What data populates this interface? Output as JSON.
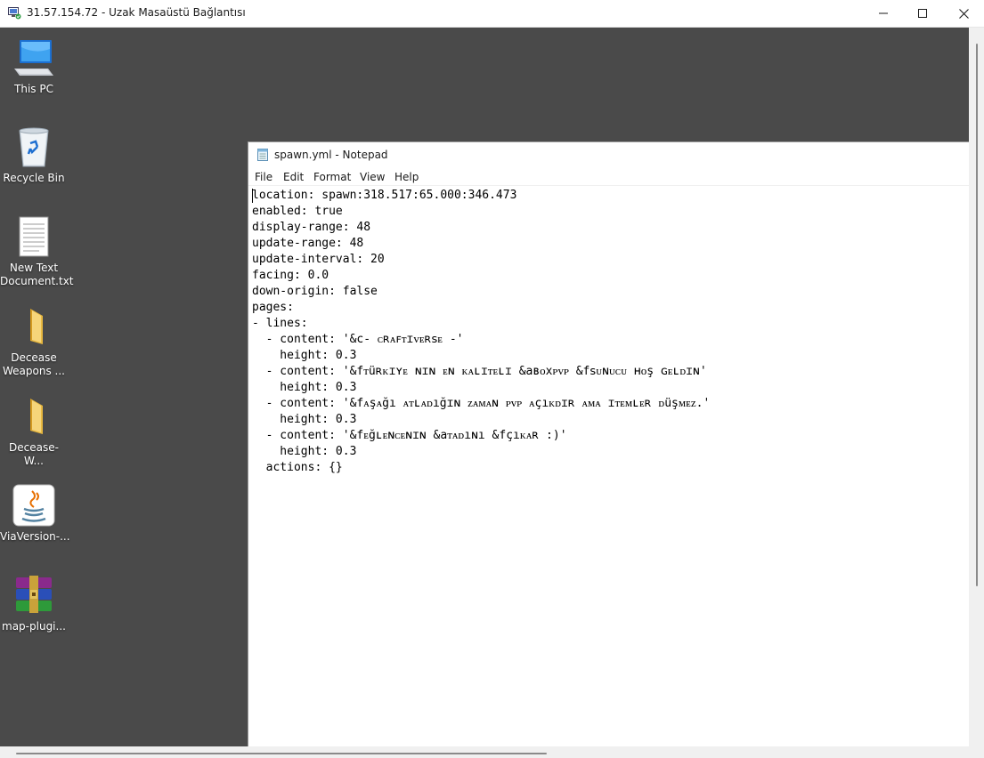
{
  "rdp": {
    "title": "31.57.154.72 - Uzak Masaüstü Bağlantısı",
    "icon": "remote-desktop-icon"
  },
  "desktop": {
    "icons": [
      {
        "label": "This PC",
        "icon": "computer-icon"
      },
      {
        "label": "Recycle Bin",
        "icon": "recycle-bin-icon"
      },
      {
        "label": "New Text Document.txt",
        "icon": "text-document-icon"
      },
      {
        "label": "Decease Weapons ...",
        "icon": "folder-icon"
      },
      {
        "label": "Decease-W...",
        "icon": "folder-icon"
      },
      {
        "label": "ViaVersion-...",
        "icon": "java-icon"
      },
      {
        "label": "map-plugi...",
        "icon": "winrar-archive-icon"
      }
    ]
  },
  "notepad": {
    "title": "spawn.yml - Notepad",
    "menu": [
      "File",
      "Edit",
      "Format",
      "View",
      "Help"
    ],
    "lines": [
      "location: spawn:318.517:65.000:346.473",
      "enabled: true",
      "display-range: 48",
      "update-range: 48",
      "update-interval: 20",
      "facing: 0.0",
      "down-origin: false",
      "pages:",
      "- lines:",
      "  - content: '&c- ᴄʀᴀꜰᴛɪᴠᴇʀꜱᴇ -'",
      "    height: 0.3",
      "  - content: '&fᴛüʀᴋɪʏᴇ ɴɪɴ ᴇɴ ᴋᴀʟɪᴛᴇʟɪ &aʙᴏxᴘᴠᴘ &fꜱᴜɴᴜᴄᴜ ʜᴏş ɢᴇʟᴅɪɴ'",
      "    height: 0.3",
      "  - content: '&fᴀşᴀğı ᴀᴛʟᴀᴅığɪɴ ᴢᴀᴍᴀɴ ᴘᴠᴘ ᴀçıᴋᴅɪʀ ᴀᴍᴀ ɪᴛᴇᴍʟᴇʀ ᴅüşᴍᴇᴢ.'",
      "    height: 0.3",
      "  - content: '&fᴇğʟᴇɴᴄᴇɴɪɴ &aᴛᴀᴅıɴı &fçıᴋᴀʀ :)'",
      "    height: 0.3",
      "  actions: {}"
    ]
  },
  "window_controls": {
    "minimize": "minimize-icon",
    "maximize": "maximize-icon",
    "close": "close-icon"
  }
}
